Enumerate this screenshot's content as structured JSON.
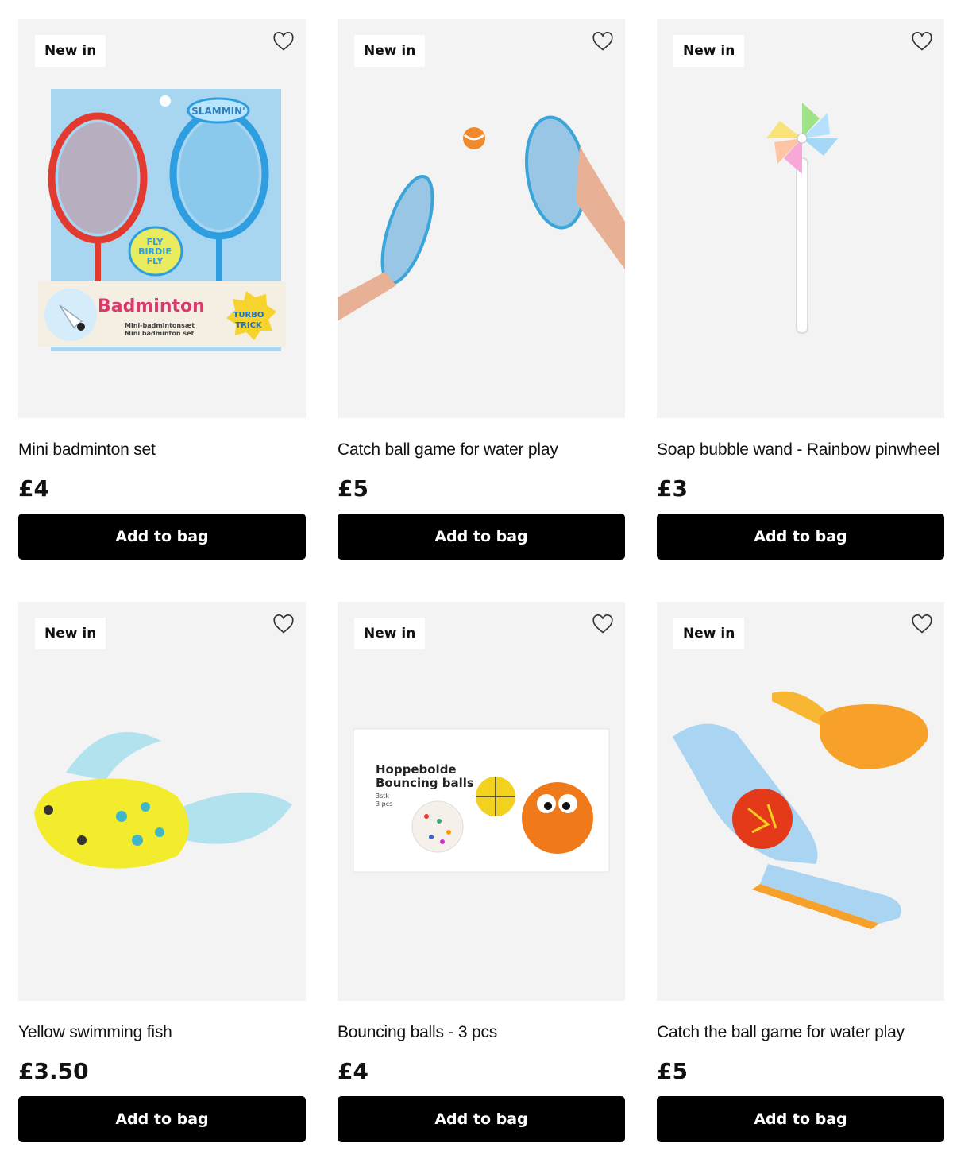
{
  "products": [
    {
      "badge": "New in",
      "title": "Mini badminton set",
      "price": "£4",
      "button": "Add to bag",
      "package_text": {
        "brand": "SLAMMIN'",
        "fly": "FLY",
        "birdie": "BIRDIE",
        "fly2": "FLY",
        "name": "Badminton",
        "turbo": "TURBO",
        "trick": "TRICK",
        "line1": "Mini-badmintonsæt",
        "line2": "Mini badminton set"
      }
    },
    {
      "badge": "New in",
      "title": "Catch ball game for water play",
      "price": "£5",
      "button": "Add to bag"
    },
    {
      "badge": "New in",
      "title": "Soap bubble wand - Rainbow pinwheel",
      "price": "£3",
      "button": "Add to bag"
    },
    {
      "badge": "New in",
      "title": "Yellow swimming fish",
      "price": "£3.50",
      "button": "Add to bag"
    },
    {
      "badge": "New in",
      "title": "Bouncing balls - 3 pcs",
      "price": "£4",
      "button": "Add to bag",
      "package_text": {
        "line1": "Hoppebolde",
        "line2": "Bouncing balls",
        "line3": "3stk",
        "line4": "3 pcs"
      }
    },
    {
      "badge": "New in",
      "title": "Catch the ball game for water play",
      "price": "£5",
      "button": "Add to bag"
    }
  ],
  "icons": {
    "favorite": "heart-outline-icon"
  },
  "colors": {
    "button_bg": "#000000",
    "image_bg": "#f3f3f3"
  }
}
